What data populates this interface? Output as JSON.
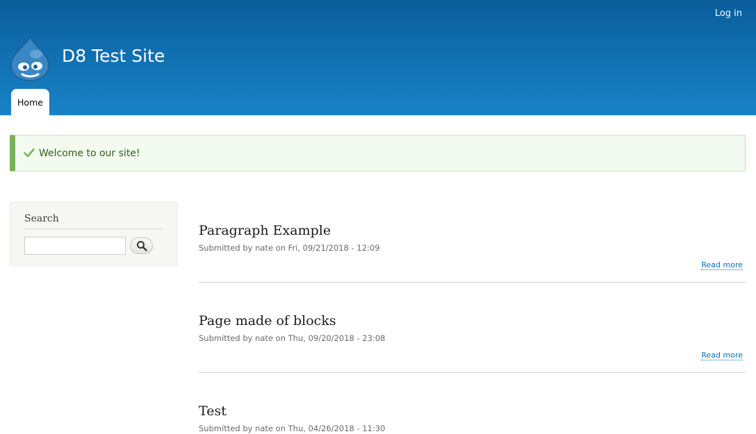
{
  "header": {
    "site_name": "D8 Test Site",
    "login_label": "Log in",
    "logo_icon": "drupal-drop-icon",
    "colors": {
      "gradient_top": "#0a5e9a",
      "gradient_bottom": "#1982c7"
    }
  },
  "nav": {
    "tabs": [
      {
        "label": "Home",
        "active": true
      }
    ]
  },
  "message": {
    "icon": "check-icon",
    "text": "Welcome to our site!",
    "colors": {
      "border": "#77b259",
      "background": "#f3faef",
      "text": "#325e1c"
    }
  },
  "sidebar": {
    "search": {
      "title": "Search",
      "input_value": "",
      "button_icon": "magnifier-icon"
    }
  },
  "articles": [
    {
      "title": "Paragraph Example",
      "meta": "Submitted by nate on Fri, 09/21/2018 - 12:09",
      "read_more": "Read more"
    },
    {
      "title": "Page made of blocks",
      "meta": "Submitted by nate on Thu, 09/20/2018 - 23:08",
      "read_more": "Read more"
    },
    {
      "title": "Test",
      "meta": "Submitted by nate on Thu, 04/26/2018 - 11:30"
    }
  ]
}
